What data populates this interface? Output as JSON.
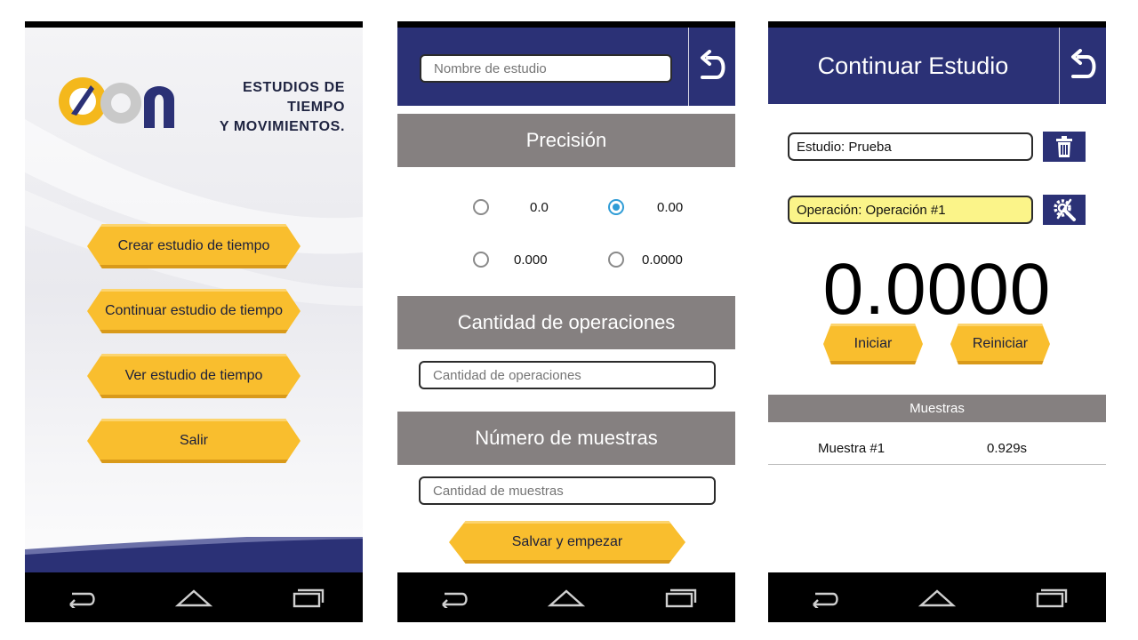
{
  "screen1": {
    "brand_line1": "ESTUDIOS DE TIEMPO",
    "brand_line2": "Y MOVIMIENTOS.",
    "menu": [
      {
        "label": "Crear estudio de tiempo"
      },
      {
        "label": "Continuar estudio de tiempo"
      },
      {
        "label": "Ver estudio de tiempo"
      },
      {
        "label": "Salir"
      }
    ]
  },
  "screen2": {
    "study_name_placeholder": "Nombre de estudio",
    "precision_header": "Precisión",
    "precision_options": [
      {
        "label": "0.0",
        "checked": false
      },
      {
        "label": "0.00",
        "checked": true
      },
      {
        "label": "0.000",
        "checked": false
      },
      {
        "label": "0.0000",
        "checked": false
      }
    ],
    "operations_header": "Cantidad de operaciones",
    "operations_placeholder": "Cantidad de operaciones",
    "samples_header": "Número de muestras",
    "samples_placeholder": "Cantidad de muestras",
    "save_button": "Salvar y empezar"
  },
  "screen3": {
    "title": "Continuar Estudio",
    "study_label": "Estudio:",
    "study_value": "Prueba",
    "operation_label": "Operación:",
    "operation_value": "Operación #1",
    "timer": "0.0000",
    "start_button": "Iniciar",
    "reset_button": "Reiniciar",
    "samples_header": "Muestras",
    "samples": [
      {
        "name": "Muestra #1",
        "value": "0.929s"
      }
    ]
  },
  "colors": {
    "navy": "#2b3176",
    "yellow": "#f9be2e",
    "grey_band": "#858080",
    "highlight": "#fbf489",
    "radio_accent": "#2f9cd6"
  },
  "icons": [
    "back-arrow-icon",
    "home-icon",
    "recents-icon",
    "undo-icon",
    "trash-icon",
    "gear-wrench-icon"
  ]
}
